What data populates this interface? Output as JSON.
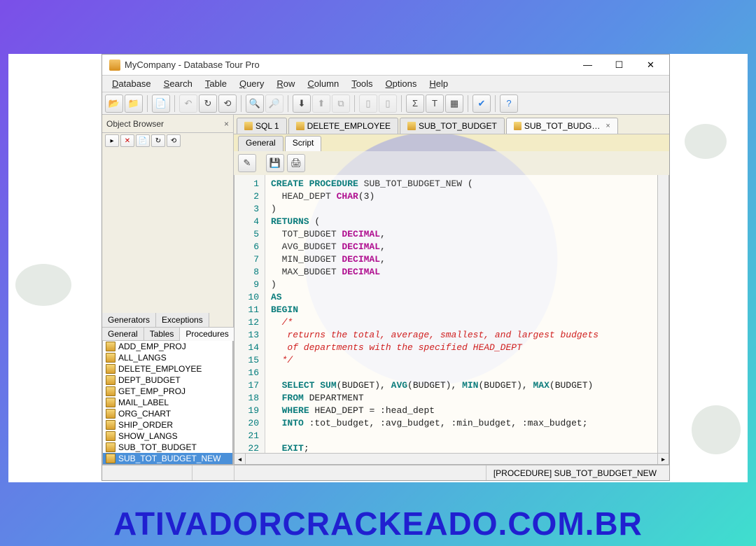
{
  "window": {
    "title": "MyCompany - Database Tour Pro"
  },
  "menus": [
    "Database",
    "Search",
    "Table",
    "Query",
    "Row",
    "Column",
    "Tools",
    "Options",
    "Help"
  ],
  "object_browser": {
    "title": "Object Browser",
    "cat_tabs": [
      "Generators",
      "Exceptions"
    ],
    "sub_tabs": [
      "General",
      "Tables",
      "Procedures"
    ],
    "active_sub": 2,
    "procedures": [
      "ADD_EMP_PROJ",
      "ALL_LANGS",
      "DELETE_EMPLOYEE",
      "DEPT_BUDGET",
      "GET_EMP_PROJ",
      "MAIL_LABEL",
      "ORG_CHART",
      "SHIP_ORDER",
      "SHOW_LANGS",
      "SUB_TOT_BUDGET",
      "SUB_TOT_BUDGET_NEW"
    ],
    "selected_index": 10
  },
  "doc_tabs": [
    {
      "label": "SQL 1",
      "active": false
    },
    {
      "label": "DELETE_EMPLOYEE",
      "active": false
    },
    {
      "label": "SUB_TOT_BUDGET",
      "active": false
    },
    {
      "label": "SUB_TOT_BUDG…",
      "active": true,
      "closeable": true
    }
  ],
  "inner_tabs": [
    "General",
    "Script"
  ],
  "active_inner": 1,
  "code_lines": [
    [
      {
        "t": "CREATE PROCEDURE",
        "c": "kw"
      },
      {
        "t": " "
      },
      {
        "t": "SUB_TOT_BUDGET_NEW",
        "c": "id"
      },
      {
        "t": " ("
      }
    ],
    [
      {
        "t": "  HEAD_DEPT ",
        "c": "id"
      },
      {
        "t": "CHAR",
        "c": "ty"
      },
      {
        "t": "(3)"
      }
    ],
    [
      {
        "t": ")"
      }
    ],
    [
      {
        "t": "RETURNS",
        "c": "kw"
      },
      {
        "t": " ("
      }
    ],
    [
      {
        "t": "  TOT_BUDGET ",
        "c": "id"
      },
      {
        "t": "DECIMAL",
        "c": "ty"
      },
      {
        "t": ","
      }
    ],
    [
      {
        "t": "  AVG_BUDGET ",
        "c": "id"
      },
      {
        "t": "DECIMAL",
        "c": "ty"
      },
      {
        "t": ","
      }
    ],
    [
      {
        "t": "  MIN_BUDGET ",
        "c": "id"
      },
      {
        "t": "DECIMAL",
        "c": "ty"
      },
      {
        "t": ","
      }
    ],
    [
      {
        "t": "  MAX_BUDGET ",
        "c": "id"
      },
      {
        "t": "DECIMAL",
        "c": "ty"
      }
    ],
    [
      {
        "t": ")"
      }
    ],
    [
      {
        "t": "AS",
        "c": "kw"
      }
    ],
    [
      {
        "t": "BEGIN",
        "c": "kw"
      }
    ],
    [
      {
        "t": "  /*",
        "c": "cm"
      }
    ],
    [
      {
        "t": "   returns the total, average, smallest, and largest budgets",
        "c": "cm"
      }
    ],
    [
      {
        "t": "   of departments with the specified HEAD_DEPT",
        "c": "cm"
      }
    ],
    [
      {
        "t": "  */",
        "c": "cm"
      }
    ],
    [
      {
        "t": ""
      }
    ],
    [
      {
        "t": "  "
      },
      {
        "t": "SELECT SUM",
        "c": "kw"
      },
      {
        "t": "(BUDGET), "
      },
      {
        "t": "AVG",
        "c": "kw"
      },
      {
        "t": "(BUDGET), "
      },
      {
        "t": "MIN",
        "c": "kw"
      },
      {
        "t": "(BUDGET), "
      },
      {
        "t": "MAX",
        "c": "kw"
      },
      {
        "t": "(BUDGET)"
      }
    ],
    [
      {
        "t": "  "
      },
      {
        "t": "FROM",
        "c": "kw"
      },
      {
        "t": " DEPARTMENT"
      }
    ],
    [
      {
        "t": "  "
      },
      {
        "t": "WHERE",
        "c": "kw"
      },
      {
        "t": " HEAD_DEPT = :head_dept"
      }
    ],
    [
      {
        "t": "  "
      },
      {
        "t": "INTO",
        "c": "kw"
      },
      {
        "t": " :tot_budget, :avg_budget, :min_budget, :max_budget;"
      }
    ],
    [
      {
        "t": ""
      }
    ],
    [
      {
        "t": "  "
      },
      {
        "t": "EXIT",
        "c": "kw"
      },
      {
        "t": ";"
      }
    ]
  ],
  "statusbar": {
    "right_cell": "[PROCEDURE] SUB_TOT_BUDGET_NEW"
  },
  "watermark": "ATIVADORCRACKEADO.COM.BR"
}
